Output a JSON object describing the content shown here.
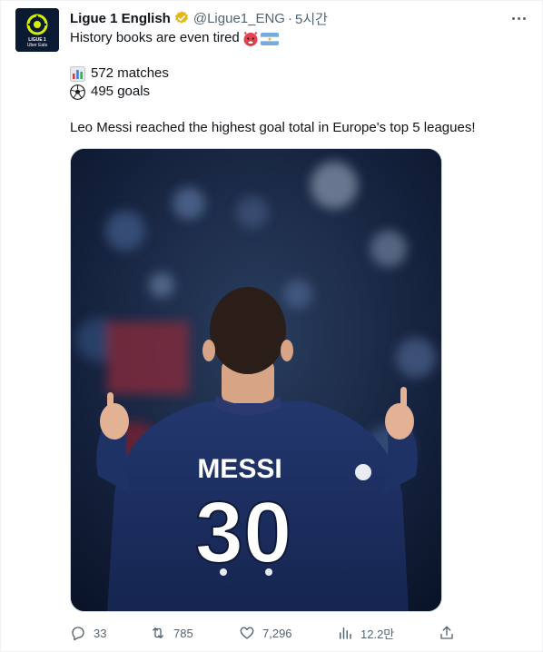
{
  "tweet": {
    "display_name": "Ligue 1 English",
    "handle": "@Ligue1_ENG",
    "separator": "·",
    "time": "5시간",
    "line1": "History books are even tired",
    "stat_matches": "572 matches",
    "stat_goals": "495 goals",
    "body": "Leo Messi reached the highest goal total in Europe's top 5 leagues!",
    "avatar_text_top": "LIGUE 1",
    "avatar_text_bottom": "Uber Eats",
    "jersey_name": "MESSI",
    "jersey_number": "30"
  },
  "actions": {
    "replies": "33",
    "retweets": "785",
    "likes": "7,296",
    "views": "12.2만"
  },
  "colors": {
    "verified_gold": "#e2b719",
    "text_secondary": "#536471",
    "jersey_navy": "#1c2f62",
    "ligue1_green": "#d4f000"
  },
  "icons": [
    "verified-badge-icon",
    "more-icon",
    "bar-chart-emoji-icon",
    "soccer-ball-emoji-icon",
    "angry-face-emoji-icon",
    "argentina-flag-icon",
    "reply-icon",
    "retweet-icon",
    "like-icon",
    "views-icon",
    "share-icon"
  ]
}
